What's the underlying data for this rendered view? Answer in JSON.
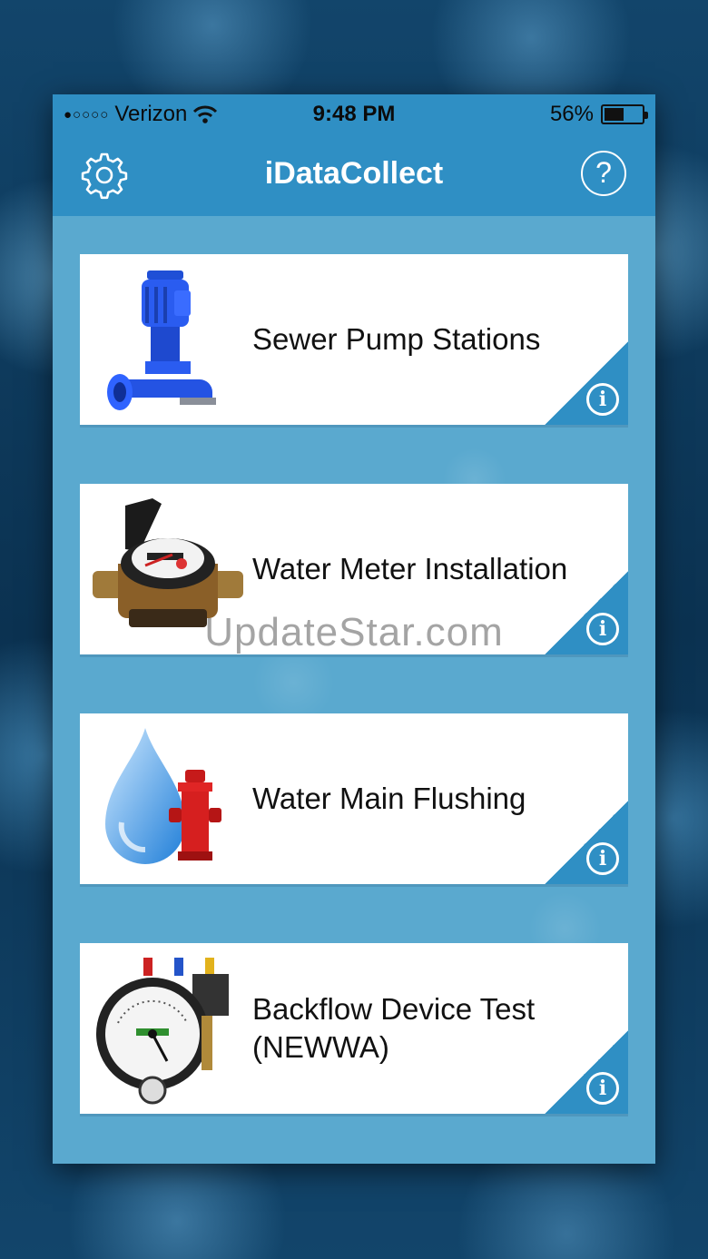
{
  "status_bar": {
    "signal": "●○○○○",
    "carrier": "Verizon",
    "time": "9:48 PM",
    "battery_percent": "56%",
    "battery_level": 0.56
  },
  "navbar": {
    "title": "iDataCollect",
    "settings_icon": "gear-icon",
    "help_label": "?"
  },
  "menu": [
    {
      "label": "Sewer Pump Stations",
      "icon": "pump-icon",
      "info": "i"
    },
    {
      "label": "Water Meter Installation",
      "icon": "water-meter-icon",
      "info": "i"
    },
    {
      "label": "Water Main Flushing",
      "icon": "hydrant-icon",
      "info": "i"
    },
    {
      "label": "Backflow Device Test (NEWWA)",
      "icon": "gauge-icon",
      "info": "i"
    }
  ],
  "watermark": "UpdateStar.com",
  "colors": {
    "header": "#2f8fc4",
    "background": "#5aa9cf",
    "card": "#ffffff",
    "text": "#111111"
  }
}
